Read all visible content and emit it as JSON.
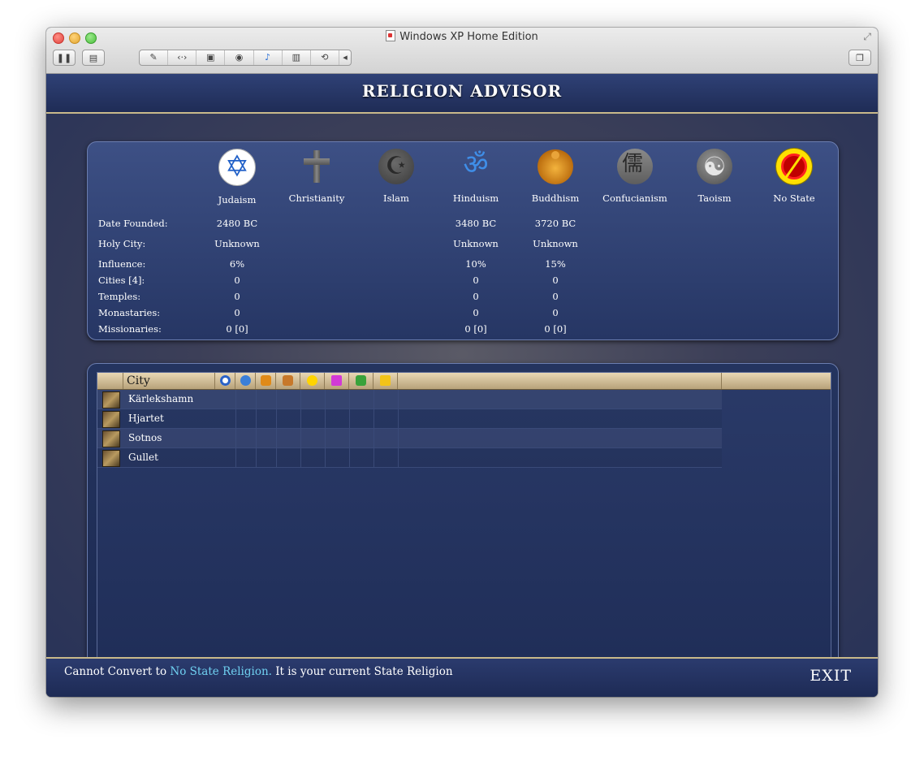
{
  "window": {
    "title": "Windows XP Home Edition",
    "toolbar_icons": [
      "pause-icon",
      "snapshot-icon",
      "settings-icon",
      "network-icon",
      "disk-icon",
      "camera-icon",
      "sound-icon",
      "usb-icon",
      "sharing-icon",
      "chevron-left-icon",
      "fullscreen-icon"
    ]
  },
  "advisor": {
    "title": "RELIGION ADVISOR",
    "religions": [
      {
        "name": "Judaism",
        "icon": "star-of-david-icon"
      },
      {
        "name": "Christianity",
        "icon": "cross-icon"
      },
      {
        "name": "Islam",
        "icon": "crescent-icon"
      },
      {
        "name": "Hinduism",
        "icon": "om-icon"
      },
      {
        "name": "Buddhism",
        "icon": "buddha-icon"
      },
      {
        "name": "Confucianism",
        "icon": "confucian-icon"
      },
      {
        "name": "Taoism",
        "icon": "yin-yang-icon"
      },
      {
        "name": "No State",
        "icon": "no-state-icon"
      }
    ],
    "row_labels": {
      "date_founded": "Date Founded:",
      "holy_city": "Holy City:",
      "influence": "Influence:",
      "cities": "Cities [4]:",
      "temples": "Temples:",
      "monastaries": "Monastaries:",
      "missionaries": "Missionaries:"
    },
    "stats": {
      "judaism": {
        "date_founded": "2480 BC",
        "holy_city": "Unknown",
        "influence": "6%",
        "cities": "0",
        "temples": "0",
        "monastaries": "0",
        "missionaries": "0 [0]"
      },
      "hinduism": {
        "date_founded": "3480 BC",
        "holy_city": "Unknown",
        "influence": "10%",
        "cities": "0",
        "temples": "0",
        "monastaries": "0",
        "missionaries": "0 [0]"
      },
      "buddhism": {
        "date_founded": "3720 BC",
        "holy_city": "Unknown",
        "influence": "15%",
        "cities": "0",
        "temples": "0",
        "monastaries": "0",
        "missionaries": "0 [0]"
      }
    }
  },
  "city_table": {
    "header_city": "City",
    "header_icons": [
      "judaism-icon",
      "hinduism-icon",
      "buddhism-icon",
      "holy-city-icon",
      "happy-face-icon",
      "culture-icon",
      "science-icon",
      "gold-icon"
    ],
    "cities": [
      "Kärlekshamn",
      "Hjartet",
      "Sotnos",
      "Gullet"
    ]
  },
  "footer": {
    "status_prefix": "Cannot Convert to ",
    "status_highlight": "No State Religion.",
    "status_suffix": " It is your current State Religion",
    "exit_label": "EXIT",
    "highlight_color": "#6fd0f0"
  }
}
